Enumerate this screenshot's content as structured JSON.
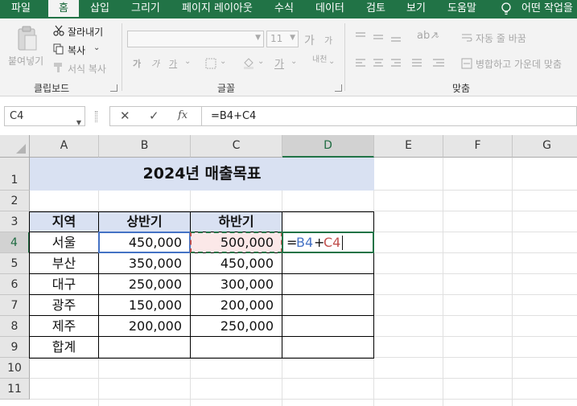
{
  "ribbon_tabs": [
    "파일",
    "홈",
    "삽입",
    "그리기",
    "페이지 레이아웃",
    "수식",
    "데이터",
    "검토",
    "보기",
    "도움말",
    "어떤 작업을"
  ],
  "active_tab": "홈",
  "clipboard": {
    "paste_label": "붙여넣기",
    "cut_label": "잘라내기",
    "copy_label": "복사",
    "format_painter_label": "서식 복사",
    "group_label": "클립보드"
  },
  "font": {
    "font_size": "11",
    "group_label": "글꼴",
    "bold_glyph": "가",
    "italic_glyph": "가",
    "underline_glyph": "가",
    "grow_glyph": "가",
    "shrink_glyph": "가",
    "phonetic_glyph": "내천"
  },
  "alignment": {
    "wrap_label": "자동 줄 바꿈",
    "merge_label": "병합하고 가운데 맞춤",
    "group_label": "맞춤"
  },
  "formula_bar": {
    "name_box": "C4",
    "cancel_glyph": "✕",
    "enter_glyph": "✓",
    "fx_glyph": "fx",
    "formula": "=B4+C4"
  },
  "columns": [
    "A",
    "B",
    "C",
    "D",
    "E",
    "F",
    "G"
  ],
  "rows": [
    "1",
    "2",
    "3",
    "4",
    "5",
    "6",
    "7",
    "8",
    "9",
    "10",
    "11"
  ],
  "sheet": {
    "title": "2024년 매출목표",
    "headers": [
      "지역",
      "상반기",
      "하반기"
    ],
    "data_rows": [
      {
        "region": "서울",
        "h1": "450,000",
        "h2": "500,000"
      },
      {
        "region": "부산",
        "h1": "350,000",
        "h2": "450,000"
      },
      {
        "region": "대구",
        "h1": "250,000",
        "h2": "300,000"
      },
      {
        "region": "광주",
        "h1": "150,000",
        "h2": "200,000"
      },
      {
        "region": "제주",
        "h1": "200,000",
        "h2": "250,000"
      }
    ],
    "total_label": "합계",
    "editing_cell": {
      "eq": "=",
      "ref1": "B4",
      "plus": "+",
      "ref2": "C4"
    }
  },
  "colors": {
    "excel_green": "#217346",
    "header_fill": "#d9e1f2",
    "ref1_color": "#4472c4",
    "ref2_color": "#c0504d",
    "ref2_fill": "#fbe8e8"
  }
}
